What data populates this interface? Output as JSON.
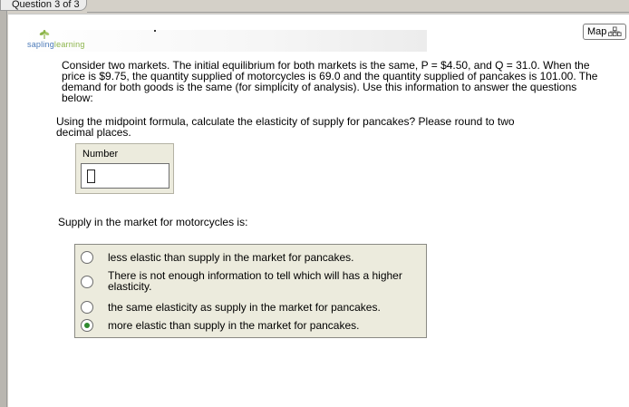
{
  "tab": {
    "label": "Question 3 of 3"
  },
  "map_button": {
    "label": "Map",
    "icon": "map-grid-icon"
  },
  "logo": {
    "part1": "sapling",
    "part2": "learning",
    "icon": "sapling-leaf-icon",
    "colors": {
      "blue": "#4b7ab8",
      "green": "#8cb44a"
    }
  },
  "question": {
    "text": "Consider two markets. The initial equilibrium for both markets is the same, P = $4.50, and Q = 31.0. When the price is $9.75, the quantity supplied of motorcycles is 69.0 and the quantity supplied of pancakes is 101.00.  The demand for both goods is the same (for simplicity of analysis). Use this information to answer the questions below:"
  },
  "part1": {
    "prompt": "Using the midpoint formula, calculate the elasticity of supply for pancakes? Please round to two decimal places.",
    "input_label": "Number",
    "input_value": ""
  },
  "part2": {
    "prompt": "Supply in the market for motorcycles is:",
    "options": [
      {
        "label": "less elastic than supply in the market for pancakes.",
        "selected": false
      },
      {
        "label": "There is not enough information to tell which will has a higher elasticity.",
        "selected": false
      },
      {
        "label": "the same elasticity as supply in the market for pancakes.",
        "selected": false
      },
      {
        "label": "more elastic than supply in the market for pancakes.",
        "selected": true
      }
    ],
    "selected_color": "#2e8a2e"
  }
}
